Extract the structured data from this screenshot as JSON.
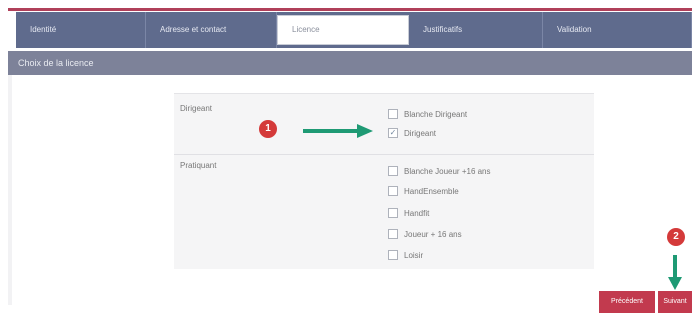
{
  "tabs": [
    {
      "label": "Identité",
      "active": false
    },
    {
      "label": "Adresse et contact",
      "active": false
    },
    {
      "label": "Licence",
      "active": true
    },
    {
      "label": "Justificatifs",
      "active": false
    },
    {
      "label": "Validation",
      "active": false
    }
  ],
  "section_title": "Choix de la licence",
  "groups": [
    {
      "label": "Dirigeant",
      "options": [
        {
          "label": "Blanche Dirigeant",
          "checked": false
        },
        {
          "label": "Dirigeant",
          "checked": true
        }
      ]
    },
    {
      "label": "Pratiquant",
      "options": [
        {
          "label": "Blanche Joueur +16 ans",
          "checked": false
        },
        {
          "label": "HandEnsemble",
          "checked": false
        },
        {
          "label": "Handfit",
          "checked": false
        },
        {
          "label": "Joueur + 16 ans",
          "checked": false
        },
        {
          "label": "Loisir",
          "checked": false
        }
      ]
    }
  ],
  "annotations": {
    "step1": "1",
    "step2": "2"
  },
  "buttons": {
    "previous": "Précédent",
    "next": "Suivant"
  },
  "colors": {
    "tab_bar": "#5f6b8d",
    "subheader": "#7d8299",
    "accent_line": "#b0405a",
    "button": "#c23a4e",
    "arrow": "#1e9a74",
    "badge": "#d43a3a"
  },
  "icons": {
    "check": "checkmark-icon",
    "arrow_right": "arrow-right-icon",
    "arrow_down": "arrow-down-icon"
  }
}
